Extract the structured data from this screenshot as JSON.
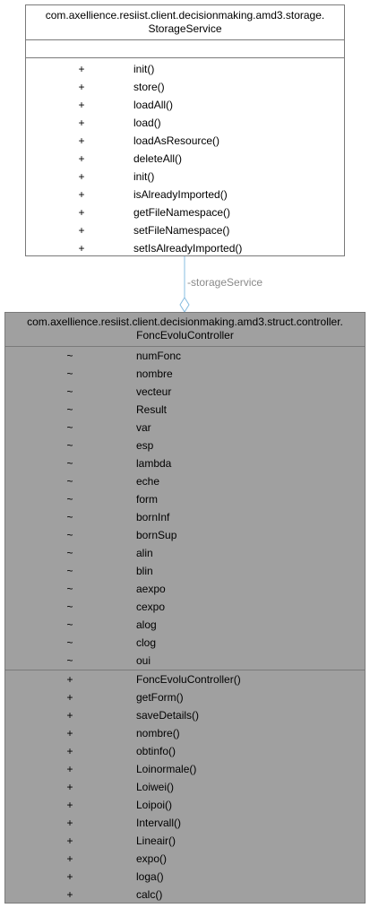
{
  "storage_class": {
    "name_line1": "com.axellience.resiist.client.decisionmaking.amd3.storage.",
    "name_line2": "StorageService",
    "operations": [
      {
        "vis": "+",
        "name": "init()"
      },
      {
        "vis": "+",
        "name": "store()"
      },
      {
        "vis": "+",
        "name": "loadAll()"
      },
      {
        "vis": "+",
        "name": "load()"
      },
      {
        "vis": "+",
        "name": "loadAsResource()"
      },
      {
        "vis": "+",
        "name": "deleteAll()"
      },
      {
        "vis": "+",
        "name": "init()"
      },
      {
        "vis": "+",
        "name": "isAlreadyImported()"
      },
      {
        "vis": "+",
        "name": "getFileNamespace()"
      },
      {
        "vis": "+",
        "name": "setFileNamespace()"
      },
      {
        "vis": "+",
        "name": "setIsAlreadyImported()"
      }
    ]
  },
  "association": {
    "label": "-storageService"
  },
  "controller_class": {
    "name_line1": "com.axellience.resiist.client.decisionmaking.amd3.struct.controller.",
    "name_line2": "FoncEvoluController",
    "attributes": [
      {
        "vis": "~",
        "name": "numFonc"
      },
      {
        "vis": "~",
        "name": "nombre"
      },
      {
        "vis": "~",
        "name": "vecteur"
      },
      {
        "vis": "~",
        "name": "Result"
      },
      {
        "vis": "~",
        "name": "var"
      },
      {
        "vis": "~",
        "name": "esp"
      },
      {
        "vis": "~",
        "name": "lambda"
      },
      {
        "vis": "~",
        "name": "eche"
      },
      {
        "vis": "~",
        "name": "form"
      },
      {
        "vis": "~",
        "name": "bornInf"
      },
      {
        "vis": "~",
        "name": "bornSup"
      },
      {
        "vis": "~",
        "name": "alin"
      },
      {
        "vis": "~",
        "name": "blin"
      },
      {
        "vis": "~",
        "name": "aexpo"
      },
      {
        "vis": "~",
        "name": "cexpo"
      },
      {
        "vis": "~",
        "name": "alog"
      },
      {
        "vis": "~",
        "name": "clog"
      },
      {
        "vis": "~",
        "name": "oui"
      }
    ],
    "operations": [
      {
        "vis": "+",
        "name": "FoncEvoluController()"
      },
      {
        "vis": "+",
        "name": "getForm()"
      },
      {
        "vis": "+",
        "name": "saveDetails()"
      },
      {
        "vis": "+",
        "name": "nombre()"
      },
      {
        "vis": "+",
        "name": "obtinfo()"
      },
      {
        "vis": "+",
        "name": "Loinormale()"
      },
      {
        "vis": "+",
        "name": "Loiwei()"
      },
      {
        "vis": "+",
        "name": "Loipoi()"
      },
      {
        "vis": "+",
        "name": "Intervall()"
      },
      {
        "vis": "+",
        "name": "Lineair()"
      },
      {
        "vis": "+",
        "name": "expo()"
      },
      {
        "vis": "+",
        "name": "loga()"
      },
      {
        "vis": "+",
        "name": "calc()"
      }
    ]
  },
  "colors": {
    "controller_fill": "#a0a0a0",
    "storage_fill": "#ffffff",
    "border": "#7a7a7a",
    "connector": "#87bde0"
  }
}
